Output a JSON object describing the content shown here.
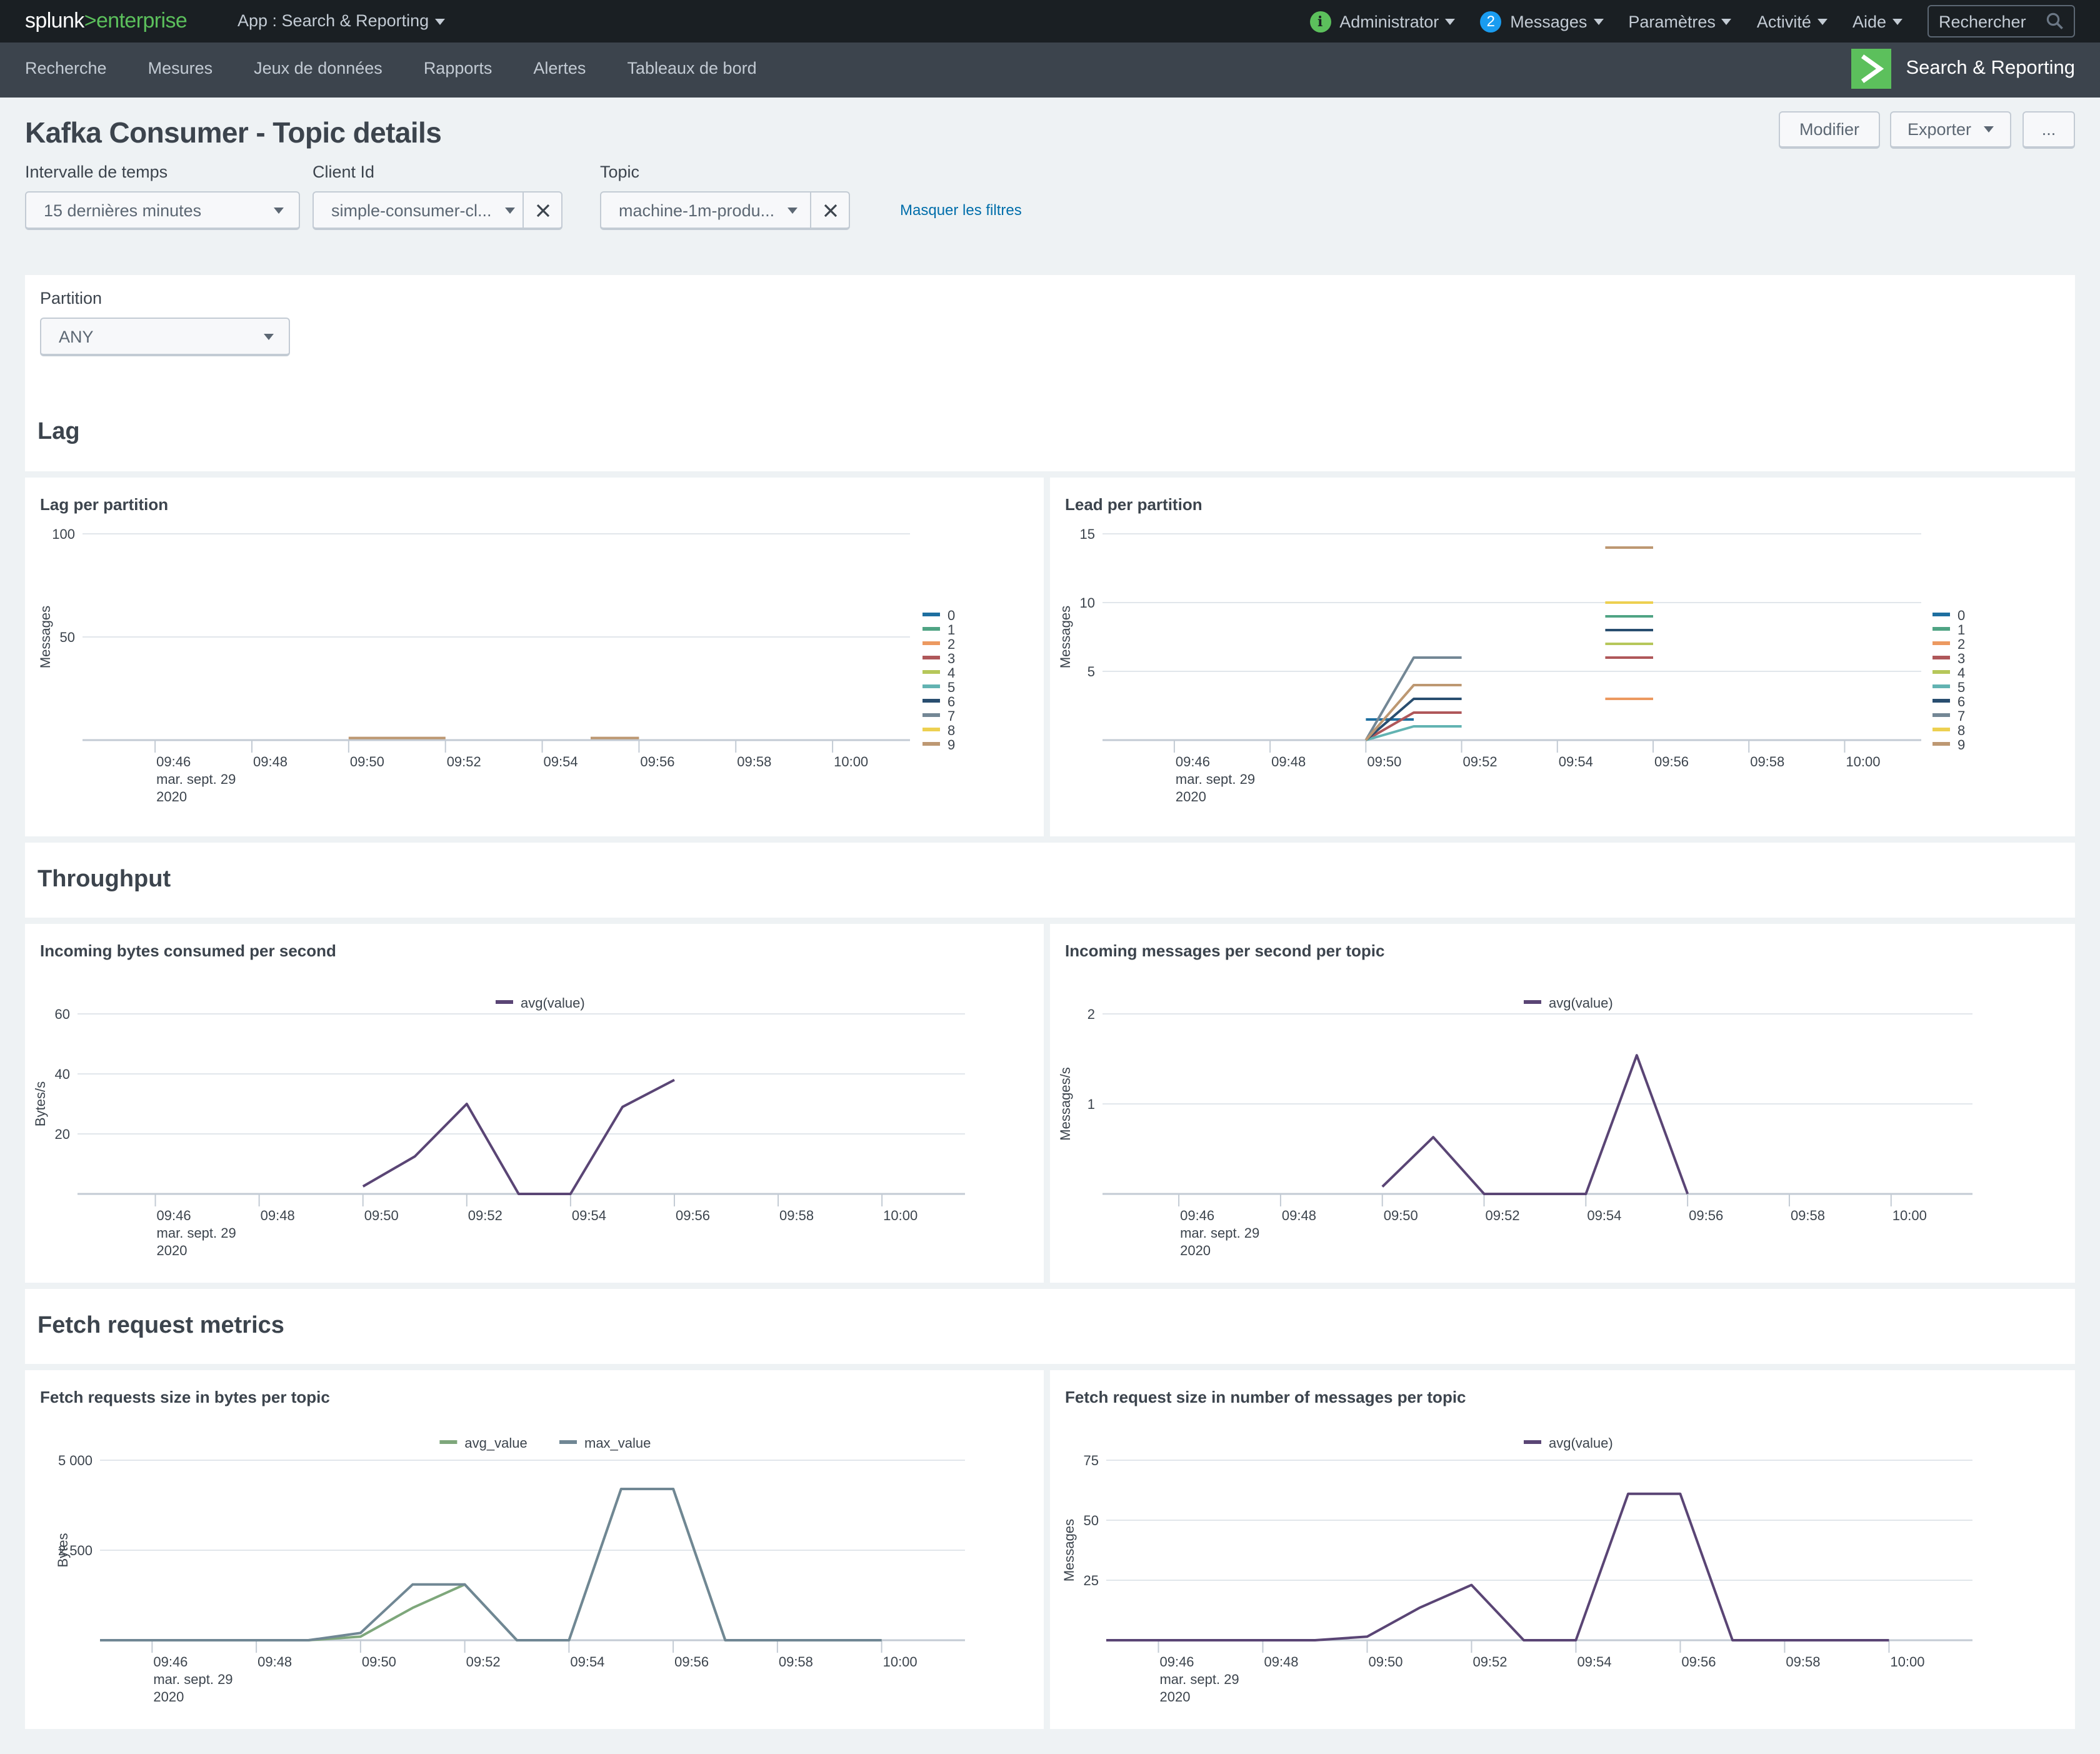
{
  "topbar": {
    "logo_splunk": "splunk",
    "logo_gt": ">",
    "logo_enterprise": "enterprise",
    "app_menu": "App : Search & Reporting",
    "user": "Administrator",
    "messages_count": "2",
    "messages": "Messages",
    "settings": "Paramètres",
    "activity": "Activité",
    "help": "Aide",
    "search_placeholder": "Rechercher"
  },
  "appbar": {
    "nav": [
      "Recherche",
      "Mesures",
      "Jeux de données",
      "Rapports",
      "Alertes",
      "Tableaux de bord"
    ],
    "app_name": "Search & Reporting"
  },
  "dashboard": {
    "title": "Kafka Consumer - Topic details",
    "edit_button": "Modifier",
    "export_button": "Exporter",
    "more_button": "...",
    "filters": {
      "time_label": "Intervalle de temps",
      "time_value": "15 dernières minutes",
      "client_label": "Client Id",
      "client_value": "simple-consumer-cl...",
      "topic_label": "Topic",
      "topic_value": "machine-1m-produ...",
      "hide_filters": "Masquer les filtres"
    },
    "partition": {
      "label": "Partition",
      "value": "ANY"
    },
    "sections": [
      "Lag",
      "Throughput",
      "Fetch request metrics"
    ]
  },
  "colors": {
    "partitions": [
      "#1e6fa0",
      "#4fa484",
      "#ec9960",
      "#af575a",
      "#b6c75a",
      "#62b3b2",
      "#294e70",
      "#738795",
      "#edd051",
      "#bd9872"
    ],
    "avg_purple": "#5a4575",
    "avg_green": "#7ea77b",
    "max_slate": "#708794",
    "grid": "#e1e6eb",
    "axis": "#c3cbd4"
  },
  "chart_data": [
    {
      "id": "lag",
      "type": "line",
      "title": "Lag per partition",
      "ylabel": "Messages",
      "xlabel": "",
      "ylim": [
        0,
        100
      ],
      "yticks": [
        "50",
        "100"
      ],
      "ytick_values": [
        50,
        100
      ],
      "xticks": [
        "09:46",
        "09:48",
        "09:50",
        "09:52",
        "09:54",
        "09:56",
        "09:58",
        "10:00"
      ],
      "x_date_label": [
        "mar. sept. 29",
        "2020"
      ],
      "legend": "right",
      "legend_entries": [
        "0",
        "1",
        "2",
        "3",
        "4",
        "5",
        "6",
        "7",
        "8",
        "9"
      ],
      "series": [
        {
          "name": "9",
          "color_index": 9,
          "segments": [
            [
              [
                "09:50",
                1
              ],
              [
                "09:51",
                1
              ],
              [
                "09:52",
                1
              ]
            ],
            [
              [
                "09:55",
                1
              ],
              [
                "09:56",
                1
              ]
            ]
          ]
        }
      ]
    },
    {
      "id": "lead",
      "type": "line",
      "title": "Lead per partition",
      "ylabel": "Messages",
      "xlabel": "",
      "ylim": [
        0,
        15
      ],
      "yticks": [
        "5",
        "10",
        "15"
      ],
      "ytick_values": [
        5,
        10,
        15
      ],
      "xticks": [
        "09:46",
        "09:48",
        "09:50",
        "09:52",
        "09:54",
        "09:56",
        "09:58",
        "10:00"
      ],
      "x_date_label": [
        "mar. sept. 29",
        "2020"
      ],
      "legend": "right",
      "legend_entries": [
        "0",
        "1",
        "2",
        "3",
        "4",
        "5",
        "6",
        "7",
        "8",
        "9"
      ],
      "series": [
        {
          "name": "0",
          "color_index": 0,
          "segments": [
            [
              [
                "09:50",
                1.5
              ],
              [
                "09:51",
                1.5
              ]
            ]
          ]
        },
        {
          "name": "1",
          "color_index": 1,
          "segments": [
            [
              [
                "09:55",
                9
              ],
              [
                "09:56",
                9
              ]
            ]
          ]
        },
        {
          "name": "2",
          "color_index": 2,
          "segments": [
            [
              [
                "09:55",
                3
              ],
              [
                "09:56",
                3
              ]
            ]
          ]
        },
        {
          "name": "3",
          "color_index": 3,
          "segments": [
            [
              [
                "09:50",
                0
              ],
              [
                "09:51",
                2
              ],
              [
                "09:52",
                2
              ]
            ],
            [
              [
                "09:55",
                6
              ],
              [
                "09:56",
                6
              ]
            ]
          ]
        },
        {
          "name": "4",
          "color_index": 4,
          "segments": [
            [
              [
                "09:55",
                7
              ],
              [
                "09:56",
                7
              ]
            ]
          ]
        },
        {
          "name": "5",
          "color_index": 5,
          "segments": [
            [
              [
                "09:50",
                0
              ],
              [
                "09:51",
                1
              ],
              [
                "09:52",
                1
              ]
            ]
          ]
        },
        {
          "name": "6",
          "color_index": 6,
          "segments": [
            [
              [
                "09:50",
                0
              ],
              [
                "09:51",
                3
              ],
              [
                "09:52",
                3
              ]
            ],
            [
              [
                "09:55",
                8
              ],
              [
                "09:56",
                8
              ]
            ]
          ]
        },
        {
          "name": "7",
          "color_index": 7,
          "segments": [
            [
              [
                "09:50",
                0
              ],
              [
                "09:51",
                6
              ],
              [
                "09:52",
                6
              ]
            ]
          ]
        },
        {
          "name": "8",
          "color_index": 8,
          "segments": [
            [
              [
                "09:55",
                10
              ],
              [
                "09:56",
                10
              ]
            ]
          ]
        },
        {
          "name": "9",
          "color_index": 9,
          "segments": [
            [
              [
                "09:50",
                0
              ],
              [
                "09:51",
                4
              ],
              [
                "09:52",
                4
              ]
            ],
            [
              [
                "09:55",
                14
              ],
              [
                "09:56",
                14
              ]
            ]
          ]
        }
      ]
    },
    {
      "id": "bytes",
      "type": "line",
      "title": "Incoming bytes consumed per second",
      "ylabel": "Bytes/s",
      "xlabel": "",
      "ylim": [
        0,
        60
      ],
      "yticks": [
        "20",
        "40",
        "60"
      ],
      "ytick_values": [
        20,
        40,
        60
      ],
      "xticks": [
        "09:46",
        "09:48",
        "09:50",
        "09:52",
        "09:54",
        "09:56",
        "09:58",
        "10:00"
      ],
      "x_date_label": [
        "mar. sept. 29",
        "2020"
      ],
      "legend": "top",
      "legend_entries": [
        "avg(value)"
      ],
      "series": [
        {
          "name": "avg(value)",
          "color_key": "avg_purple",
          "segments": [
            [
              [
                "09:50",
                2.5
              ],
              [
                "09:51",
                12.5
              ],
              [
                "09:52",
                30
              ],
              [
                "09:53",
                0
              ],
              [
                "09:54",
                0
              ],
              [
                "09:55",
                29
              ],
              [
                "09:56",
                38
              ]
            ]
          ]
        }
      ]
    },
    {
      "id": "msgs",
      "type": "line",
      "title": "Incoming messages per second per topic",
      "ylabel": "Messages/s",
      "xlabel": "",
      "ylim": [
        0,
        2
      ],
      "yticks": [
        "1",
        "2"
      ],
      "ytick_values": [
        1,
        2
      ],
      "xticks": [
        "09:46",
        "09:48",
        "09:50",
        "09:52",
        "09:54",
        "09:56",
        "09:58",
        "10:00"
      ],
      "x_date_label": [
        "mar. sept. 29",
        "2020"
      ],
      "legend": "top",
      "legend_entries": [
        "avg(value)"
      ],
      "series": [
        {
          "name": "avg(value)",
          "color_key": "avg_purple",
          "segments": [
            [
              [
                "09:50",
                0.08
              ],
              [
                "09:51",
                0.63
              ],
              [
                "09:52",
                0
              ],
              [
                "09:53",
                0
              ],
              [
                "09:54",
                0
              ],
              [
                "09:55",
                1.54
              ],
              [
                "09:56",
                0
              ]
            ]
          ]
        }
      ]
    },
    {
      "id": "fetchbytes",
      "type": "line",
      "title": "Fetch requests size in bytes per topic",
      "ylabel": "Bytes",
      "xlabel": "",
      "ylim": [
        0,
        5000
      ],
      "yticks": [
        "2 500",
        "5 000"
      ],
      "ytick_values": [
        2500,
        5000
      ],
      "xticks": [
        "09:46",
        "09:48",
        "09:50",
        "09:52",
        "09:54",
        "09:56",
        "09:58",
        "10:00"
      ],
      "x_date_label": [
        "mar. sept. 29",
        "2020"
      ],
      "legend": "top",
      "legend_entries": [
        "avg_value",
        "max_value"
      ],
      "series": [
        {
          "name": "avg_value",
          "color_key": "avg_green",
          "segments": [
            [
              [
                "09:45",
                0
              ],
              [
                "09:46",
                0
              ],
              [
                "09:47",
                0
              ],
              [
                "09:48",
                0
              ],
              [
                "09:49",
                0
              ],
              [
                "09:50",
                100
              ],
              [
                "09:51",
                900
              ],
              [
                "09:52",
                1550
              ],
              [
                "09:53",
                0
              ],
              [
                "09:54",
                0
              ],
              [
                "09:55",
                4200
              ],
              [
                "09:56",
                4200
              ],
              [
                "09:57",
                0
              ],
              [
                "09:58",
                0
              ],
              [
                "09:59",
                0
              ],
              [
                "10:00",
                0
              ]
            ]
          ]
        },
        {
          "name": "max_value",
          "color_key": "max_slate",
          "segments": [
            [
              [
                "09:45",
                0
              ],
              [
                "09:46",
                0
              ],
              [
                "09:47",
                0
              ],
              [
                "09:48",
                0
              ],
              [
                "09:49",
                0
              ],
              [
                "09:50",
                200
              ],
              [
                "09:51",
                1550
              ],
              [
                "09:52",
                1550
              ],
              [
                "09:53",
                0
              ],
              [
                "09:54",
                0
              ],
              [
                "09:55",
                4200
              ],
              [
                "09:56",
                4200
              ],
              [
                "09:57",
                0
              ],
              [
                "09:58",
                0
              ],
              [
                "09:59",
                0
              ],
              [
                "10:00",
                0
              ]
            ]
          ]
        }
      ]
    },
    {
      "id": "fetchmsgs",
      "type": "line",
      "title": "Fetch request size in number of messages per topic",
      "ylabel": "Messages",
      "xlabel": "",
      "ylim": [
        0,
        75
      ],
      "yticks": [
        "25",
        "50",
        "75"
      ],
      "ytick_values": [
        25,
        50,
        75
      ],
      "xticks": [
        "09:46",
        "09:48",
        "09:50",
        "09:52",
        "09:54",
        "09:56",
        "09:58",
        "10:00"
      ],
      "x_date_label": [
        "mar. sept. 29",
        "2020"
      ],
      "legend": "top",
      "legend_entries": [
        "avg(value)"
      ],
      "series": [
        {
          "name": "avg(value)",
          "color_key": "avg_purple",
          "segments": [
            [
              [
                "09:45",
                0
              ],
              [
                "09:46",
                0
              ],
              [
                "09:47",
                0
              ],
              [
                "09:48",
                0
              ],
              [
                "09:49",
                0
              ],
              [
                "09:50",
                1.5
              ],
              [
                "09:51",
                13.5
              ],
              [
                "09:52",
                23
              ],
              [
                "09:53",
                0
              ],
              [
                "09:54",
                0
              ],
              [
                "09:55",
                61
              ],
              [
                "09:56",
                61
              ],
              [
                "09:57",
                0
              ],
              [
                "09:58",
                0
              ],
              [
                "09:59",
                0
              ],
              [
                "10:00",
                0
              ]
            ]
          ]
        }
      ]
    }
  ]
}
